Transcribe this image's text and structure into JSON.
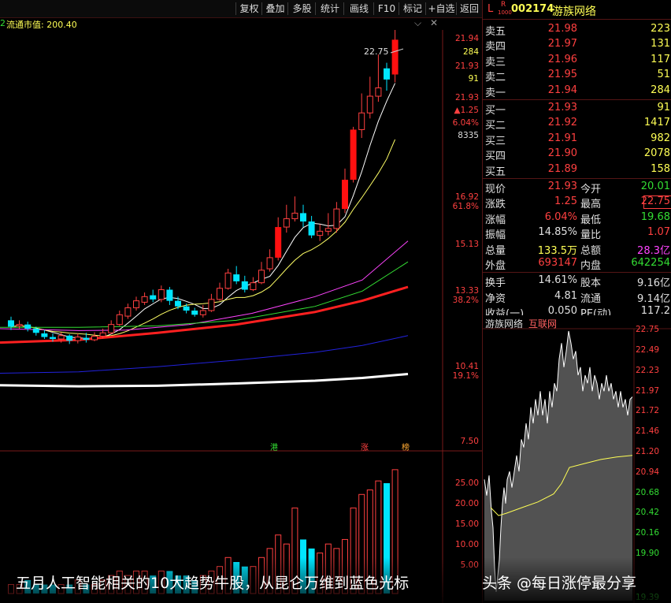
{
  "toolbar": {
    "buttons": [
      "复权",
      "叠加",
      "多股",
      "统计",
      "画线",
      "F10",
      "标记",
      "+自选",
      "返回"
    ]
  },
  "indicator_strip": {
    "prefix": "2",
    "label": "流通市值: 200.40",
    "icons": [
      "chevron-down-icon",
      "close-icon"
    ]
  },
  "main_chart": {
    "peak_label": "22.75",
    "right_axis": [
      "21.94",
      "284",
      "21.93",
      "91",
      "21.93",
      "▲1.25",
      "6.04%",
      "8335",
      "16.92",
      "61.8%",
      "15.13",
      "13.33",
      "38.2%",
      "10.41",
      "19.1%",
      "7.50"
    ],
    "markers": [
      "港",
      "涨",
      "榜"
    ]
  },
  "volume_chart": {
    "axis": [
      "25.00",
      "20.00",
      "15.00",
      "10.00",
      "5.00"
    ]
  },
  "right_panel": {
    "code": "002174",
    "name": "游族网络",
    "badge_l": "L",
    "badge_r": "R",
    "badge_sub": "1000",
    "asks": [
      {
        "label": "卖五",
        "price": "21.98",
        "vol": "223"
      },
      {
        "label": "卖四",
        "price": "21.97",
        "vol": "131"
      },
      {
        "label": "卖三",
        "price": "21.96",
        "vol": "117"
      },
      {
        "label": "卖二",
        "price": "21.95",
        "vol": "51"
      },
      {
        "label": "卖一",
        "price": "21.94",
        "vol": "284"
      }
    ],
    "bids": [
      {
        "label": "买一",
        "price": "21.93",
        "vol": "91"
      },
      {
        "label": "买二",
        "price": "21.92",
        "vol": "1417"
      },
      {
        "label": "买三",
        "price": "21.91",
        "vol": "982"
      },
      {
        "label": "买四",
        "price": "21.90",
        "vol": "2078"
      },
      {
        "label": "买五",
        "price": "21.89",
        "vol": "158"
      }
    ],
    "quote": [
      {
        "l1": "现价",
        "v1": "21.93",
        "l2": "今开",
        "v2": "20.01"
      },
      {
        "l1": "涨跌",
        "v1": "1.25",
        "l2": "最高",
        "v2": "22.75"
      },
      {
        "l1": "涨幅",
        "v1": "6.04%",
        "l2": "最低",
        "v2": "19.68"
      },
      {
        "l1": "振幅",
        "v1": "14.85%",
        "l2": "量比",
        "v2": "1.07"
      },
      {
        "l1": "总量",
        "v1": "133.5万",
        "l2": "总额",
        "v2": "28.3亿"
      },
      {
        "l1": "外盘",
        "v1": "693147",
        "l2": "内盘",
        "v2": "642254"
      }
    ],
    "stats": [
      {
        "l1": "换手",
        "v1": "14.61%",
        "l2": "股本",
        "v2": "9.16亿"
      },
      {
        "l1": "净资",
        "v1": "4.81",
        "l2": "流通",
        "v2": "9.14亿"
      },
      {
        "l1": "收益(一)",
        "v1": "0.050",
        "l2": "PE(动)",
        "v2": "117.2"
      }
    ]
  },
  "intraday": {
    "title": "游族网络",
    "link": "互联网",
    "axis": [
      "22.75",
      "22.49",
      "22.23",
      "21.97",
      "21.72",
      "21.46",
      "21.20",
      "20.94",
      "20.68",
      "20.42",
      "20.16",
      "19.90",
      "19.39"
    ]
  },
  "caption": {
    "text": "五月人工智能相关的10大趋势牛股，从昆仑万维到蓝色光标",
    "watermark": "头条 @每日涨停最分享"
  },
  "colors": {
    "up": "#ff4040",
    "down": "#00e5ff",
    "ma5": "#ffffff",
    "ma10": "#ffff66",
    "ma20": "#ff44ff",
    "ma30": "#33dd33",
    "ma60": "#ff2020",
    "ma120": "#2222dd",
    "ma250": "#ffffff"
  }
}
